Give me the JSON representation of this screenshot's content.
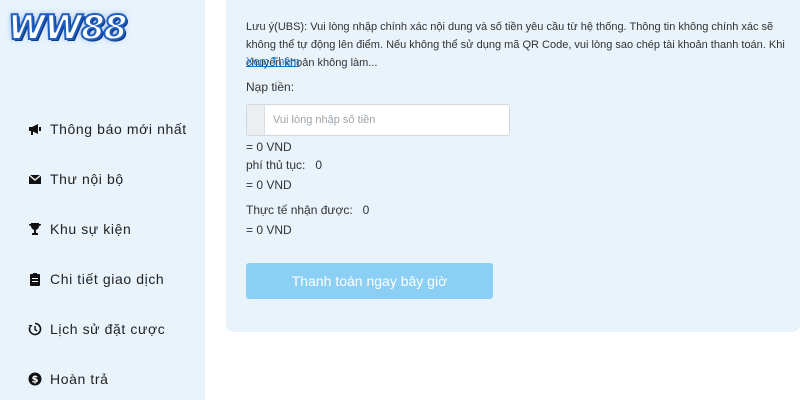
{
  "logo": {
    "text": "WW88"
  },
  "sidebar": {
    "items": [
      {
        "label": "Thông báo mới nhất",
        "icon": "megaphone-icon"
      },
      {
        "label": "Thư nội bộ",
        "icon": "envelope-icon"
      },
      {
        "label": "Khu sự kiện",
        "icon": "trophy-icon"
      },
      {
        "label": "Chi tiết giao dịch",
        "icon": "clipboard-icon"
      },
      {
        "label": "Lịch sử đặt cược",
        "icon": "history-icon"
      },
      {
        "label": "Hoàn trả",
        "icon": "dollar-circle-icon"
      }
    ]
  },
  "deposit": {
    "notice": "Lưu ý(UBS): Vui lòng nhập chính xác nội dung và số tiền yêu cầu từ hệ thống. Thông tin không chính xác sẽ không thể tự động lên điểm. Nếu không thể sử dụng mã QR Code, vui lòng sao chép tài khoản thanh toán. Khi chuyển khoản không làm...",
    "more_link": "Xem Thêm",
    "amount_label": "Nạp tiền:",
    "amount_placeholder": "Vui lòng nhập số tiền",
    "amount_converted": "= 0 VND",
    "fee_label": "phí thủ tục:",
    "fee_value": "0",
    "fee_converted": "= 0 VND",
    "received_label": "Thực tế nhận được:",
    "received_value": "0",
    "received_converted": "= 0 VND",
    "pay_button": "Thanh toán ngay bây giờ"
  },
  "colors": {
    "panel_bg": "#e8f3fc",
    "link": "#1a73c7",
    "button": "#8ccff5",
    "logo": "#1f5fbf"
  }
}
